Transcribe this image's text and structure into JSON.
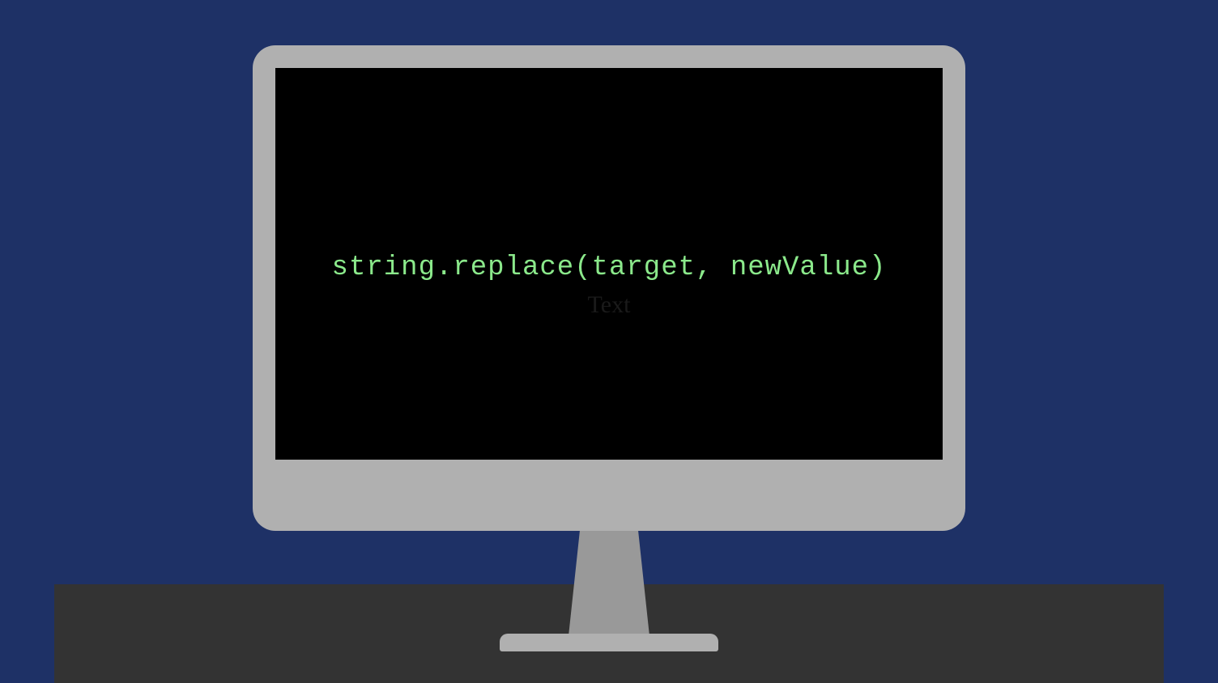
{
  "screen": {
    "code": "string.replace(target, newValue)",
    "hidden_label": "Text"
  },
  "colors": {
    "background": "#1e3166",
    "desk": "#333333",
    "monitor": "#b0b0b0",
    "screen": "#000000",
    "code_text": "#8be98b"
  }
}
